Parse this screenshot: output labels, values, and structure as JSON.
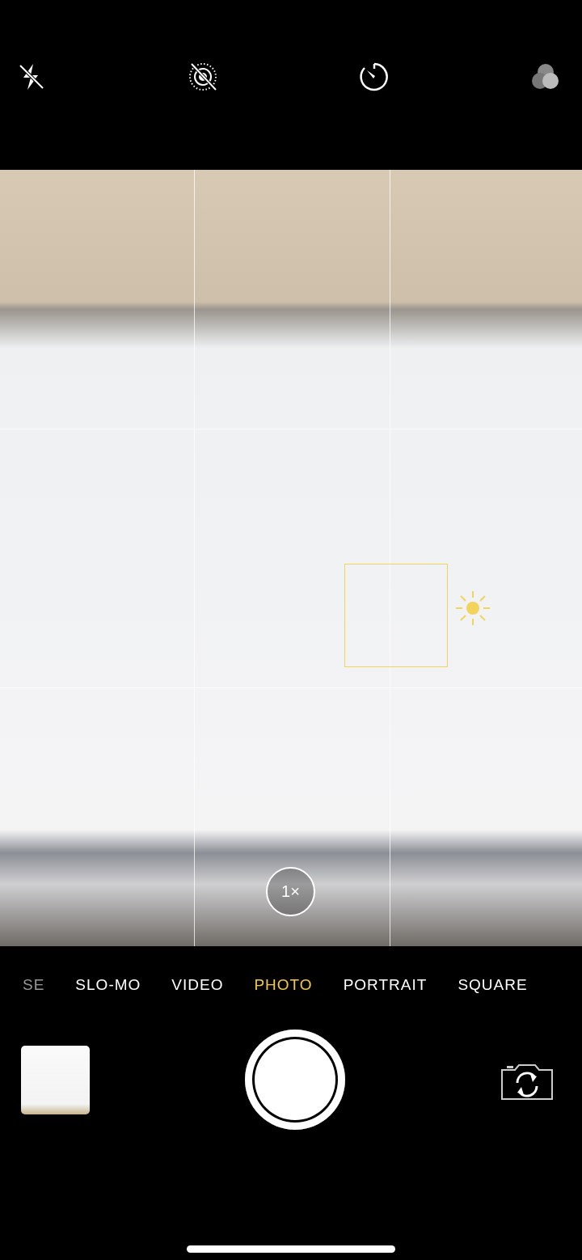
{
  "top_controls": [
    {
      "kind": "flash-off"
    },
    {
      "kind": "live-off"
    },
    {
      "kind": "timer"
    },
    {
      "kind": "filters"
    }
  ],
  "viewfinder": {
    "zoom": "1×",
    "grid": true
  },
  "modes": [
    {
      "label": "SE",
      "selected": false
    },
    {
      "label": "SLO-MO",
      "selected": false
    },
    {
      "label": "VIDEO",
      "selected": false
    },
    {
      "label": "PHOTO",
      "selected": true
    },
    {
      "label": "PORTRAIT",
      "selected": false
    },
    {
      "label": "SQUARE",
      "selected": false
    }
  ]
}
